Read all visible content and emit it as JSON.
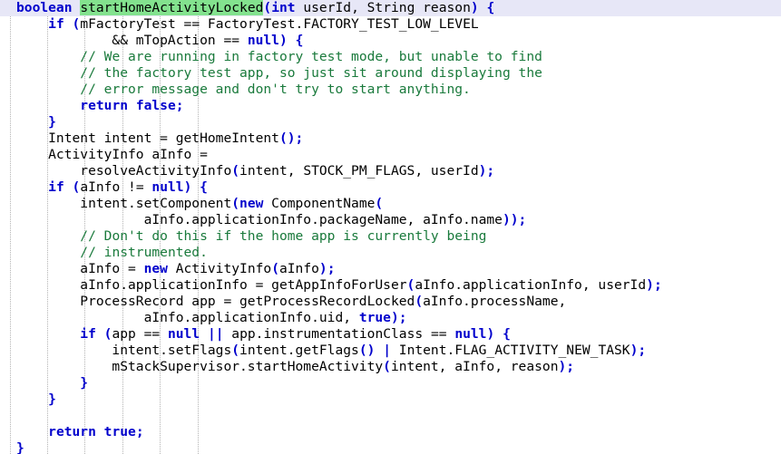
{
  "editor": {
    "title": "code-viewer",
    "language": "java",
    "colors": {
      "background": "#ffffff",
      "text": "#000000",
      "keyword": "#0000cc",
      "comment": "#1a7a3c",
      "punctuation": "#0000cc",
      "current_line_highlight": "#e7e7f7",
      "search_match_highlight": "#83e28e",
      "indent_guide": "#b4b4b4"
    },
    "indent_guides_x": [
      11,
      52,
      93,
      135,
      176,
      218
    ],
    "lines": [
      {
        "highlighted": true,
        "tokens": [
          {
            "t": "boolean",
            "c": "kw"
          },
          {
            "t": " ",
            "c": "plain"
          },
          {
            "t": "startHomeActivityLocked",
            "c": "name-hl"
          },
          {
            "t": "(",
            "c": "punc"
          },
          {
            "t": "int",
            "c": "kw"
          },
          {
            "t": " userId, String reason",
            "c": "plain"
          },
          {
            "t": ")",
            "c": "punc"
          },
          {
            "t": " ",
            "c": "plain"
          },
          {
            "t": "{",
            "c": "punc"
          }
        ]
      },
      {
        "highlighted": false,
        "tokens": [
          {
            "t": "    ",
            "c": "plain"
          },
          {
            "t": "if",
            "c": "kw"
          },
          {
            "t": " ",
            "c": "plain"
          },
          {
            "t": "(",
            "c": "punc"
          },
          {
            "t": "mFactoryTest == FactoryTest.FACTORY_TEST_LOW_LEVEL",
            "c": "plain"
          }
        ]
      },
      {
        "highlighted": false,
        "tokens": [
          {
            "t": "            && mTopAction == ",
            "c": "plain"
          },
          {
            "t": "null",
            "c": "kw"
          },
          {
            "t": ")",
            "c": "punc"
          },
          {
            "t": " ",
            "c": "plain"
          },
          {
            "t": "{",
            "c": "punc"
          }
        ]
      },
      {
        "highlighted": false,
        "tokens": [
          {
            "t": "        ",
            "c": "plain"
          },
          {
            "t": "// We are running in factory test mode, but unable to find",
            "c": "comment"
          }
        ]
      },
      {
        "highlighted": false,
        "tokens": [
          {
            "t": "        ",
            "c": "plain"
          },
          {
            "t": "// the factory test app, so just sit around displaying the",
            "c": "comment"
          }
        ]
      },
      {
        "highlighted": false,
        "tokens": [
          {
            "t": "        ",
            "c": "plain"
          },
          {
            "t": "// error message and don't try to start anything.",
            "c": "comment"
          }
        ]
      },
      {
        "highlighted": false,
        "tokens": [
          {
            "t": "        ",
            "c": "plain"
          },
          {
            "t": "return",
            "c": "kw"
          },
          {
            "t": " ",
            "c": "plain"
          },
          {
            "t": "false",
            "c": "kw"
          },
          {
            "t": ";",
            "c": "punc"
          }
        ]
      },
      {
        "highlighted": false,
        "tokens": [
          {
            "t": "    ",
            "c": "plain"
          },
          {
            "t": "}",
            "c": "punc"
          }
        ]
      },
      {
        "highlighted": false,
        "tokens": [
          {
            "t": "    Intent intent = getHomeIntent",
            "c": "plain"
          },
          {
            "t": "()",
            "c": "punc"
          },
          {
            "t": ";",
            "c": "punc"
          }
        ]
      },
      {
        "highlighted": false,
        "tokens": [
          {
            "t": "    ActivityInfo aInfo =",
            "c": "plain"
          }
        ]
      },
      {
        "highlighted": false,
        "tokens": [
          {
            "t": "        resolveActivityInfo",
            "c": "plain"
          },
          {
            "t": "(",
            "c": "punc"
          },
          {
            "t": "intent, STOCK_PM_FLAGS, userId",
            "c": "plain"
          },
          {
            "t": ")",
            "c": "punc"
          },
          {
            "t": ";",
            "c": "punc"
          }
        ]
      },
      {
        "highlighted": false,
        "tokens": [
          {
            "t": "    ",
            "c": "plain"
          },
          {
            "t": "if",
            "c": "kw"
          },
          {
            "t": " ",
            "c": "plain"
          },
          {
            "t": "(",
            "c": "punc"
          },
          {
            "t": "aInfo != ",
            "c": "plain"
          },
          {
            "t": "null",
            "c": "kw"
          },
          {
            "t": ")",
            "c": "punc"
          },
          {
            "t": " ",
            "c": "plain"
          },
          {
            "t": "{",
            "c": "punc"
          }
        ]
      },
      {
        "highlighted": false,
        "tokens": [
          {
            "t": "        intent.setComponent",
            "c": "plain"
          },
          {
            "t": "(",
            "c": "punc"
          },
          {
            "t": "new",
            "c": "kw"
          },
          {
            "t": " ComponentName",
            "c": "plain"
          },
          {
            "t": "(",
            "c": "punc"
          }
        ]
      },
      {
        "highlighted": false,
        "tokens": [
          {
            "t": "                aInfo.applicationInfo.packageName, aInfo.name",
            "c": "plain"
          },
          {
            "t": "))",
            "c": "punc"
          },
          {
            "t": ";",
            "c": "punc"
          }
        ]
      },
      {
        "highlighted": false,
        "tokens": [
          {
            "t": "        ",
            "c": "plain"
          },
          {
            "t": "// Don't do this if the home app is currently being",
            "c": "comment"
          }
        ]
      },
      {
        "highlighted": false,
        "tokens": [
          {
            "t": "        ",
            "c": "plain"
          },
          {
            "t": "// instrumented.",
            "c": "comment"
          }
        ]
      },
      {
        "highlighted": false,
        "tokens": [
          {
            "t": "        aInfo = ",
            "c": "plain"
          },
          {
            "t": "new",
            "c": "kw"
          },
          {
            "t": " ActivityInfo",
            "c": "plain"
          },
          {
            "t": "(",
            "c": "punc"
          },
          {
            "t": "aInfo",
            "c": "plain"
          },
          {
            "t": ")",
            "c": "punc"
          },
          {
            "t": ";",
            "c": "punc"
          }
        ]
      },
      {
        "highlighted": false,
        "tokens": [
          {
            "t": "        aInfo.applicationInfo = getAppInfoForUser",
            "c": "plain"
          },
          {
            "t": "(",
            "c": "punc"
          },
          {
            "t": "aInfo.applicationInfo, userId",
            "c": "plain"
          },
          {
            "t": ")",
            "c": "punc"
          },
          {
            "t": ";",
            "c": "punc"
          }
        ]
      },
      {
        "highlighted": false,
        "tokens": [
          {
            "t": "        ProcessRecord app = getProcessRecordLocked",
            "c": "plain"
          },
          {
            "t": "(",
            "c": "punc"
          },
          {
            "t": "aInfo.processName,",
            "c": "plain"
          }
        ]
      },
      {
        "highlighted": false,
        "tokens": [
          {
            "t": "                aInfo.applicationInfo.uid, ",
            "c": "plain"
          },
          {
            "t": "true",
            "c": "kw"
          },
          {
            "t": ")",
            "c": "punc"
          },
          {
            "t": ";",
            "c": "punc"
          }
        ]
      },
      {
        "highlighted": false,
        "tokens": [
          {
            "t": "        ",
            "c": "plain"
          },
          {
            "t": "if",
            "c": "kw"
          },
          {
            "t": " ",
            "c": "plain"
          },
          {
            "t": "(",
            "c": "punc"
          },
          {
            "t": "app == ",
            "c": "plain"
          },
          {
            "t": "null",
            "c": "kw"
          },
          {
            "t": " ",
            "c": "plain"
          },
          {
            "t": "||",
            "c": "punc"
          },
          {
            "t": " app.instrumentationClass == ",
            "c": "plain"
          },
          {
            "t": "null",
            "c": "kw"
          },
          {
            "t": ")",
            "c": "punc"
          },
          {
            "t": " ",
            "c": "plain"
          },
          {
            "t": "{",
            "c": "punc"
          }
        ]
      },
      {
        "highlighted": false,
        "tokens": [
          {
            "t": "            intent.setFlags",
            "c": "plain"
          },
          {
            "t": "(",
            "c": "punc"
          },
          {
            "t": "intent.getFlags",
            "c": "plain"
          },
          {
            "t": "()",
            "c": "punc"
          },
          {
            "t": " ",
            "c": "plain"
          },
          {
            "t": "|",
            "c": "punc"
          },
          {
            "t": " Intent.FLAG_ACTIVITY_NEW_TASK",
            "c": "plain"
          },
          {
            "t": ")",
            "c": "punc"
          },
          {
            "t": ";",
            "c": "punc"
          }
        ]
      },
      {
        "highlighted": false,
        "tokens": [
          {
            "t": "            mStackSupervisor.startHomeActivity",
            "c": "plain"
          },
          {
            "t": "(",
            "c": "punc"
          },
          {
            "t": "intent, aInfo, reason",
            "c": "plain"
          },
          {
            "t": ")",
            "c": "punc"
          },
          {
            "t": ";",
            "c": "punc"
          }
        ]
      },
      {
        "highlighted": false,
        "tokens": [
          {
            "t": "        ",
            "c": "plain"
          },
          {
            "t": "}",
            "c": "punc"
          }
        ]
      },
      {
        "highlighted": false,
        "tokens": [
          {
            "t": "    ",
            "c": "plain"
          },
          {
            "t": "}",
            "c": "punc"
          }
        ]
      },
      {
        "highlighted": false,
        "tokens": []
      },
      {
        "highlighted": false,
        "tokens": [
          {
            "t": "    ",
            "c": "plain"
          },
          {
            "t": "return",
            "c": "kw"
          },
          {
            "t": " ",
            "c": "plain"
          },
          {
            "t": "true",
            "c": "kw"
          },
          {
            "t": ";",
            "c": "punc"
          }
        ]
      },
      {
        "highlighted": false,
        "tokens": [
          {
            "t": "",
            "c": "plain"
          },
          {
            "t": "}",
            "c": "punc"
          }
        ]
      }
    ]
  }
}
